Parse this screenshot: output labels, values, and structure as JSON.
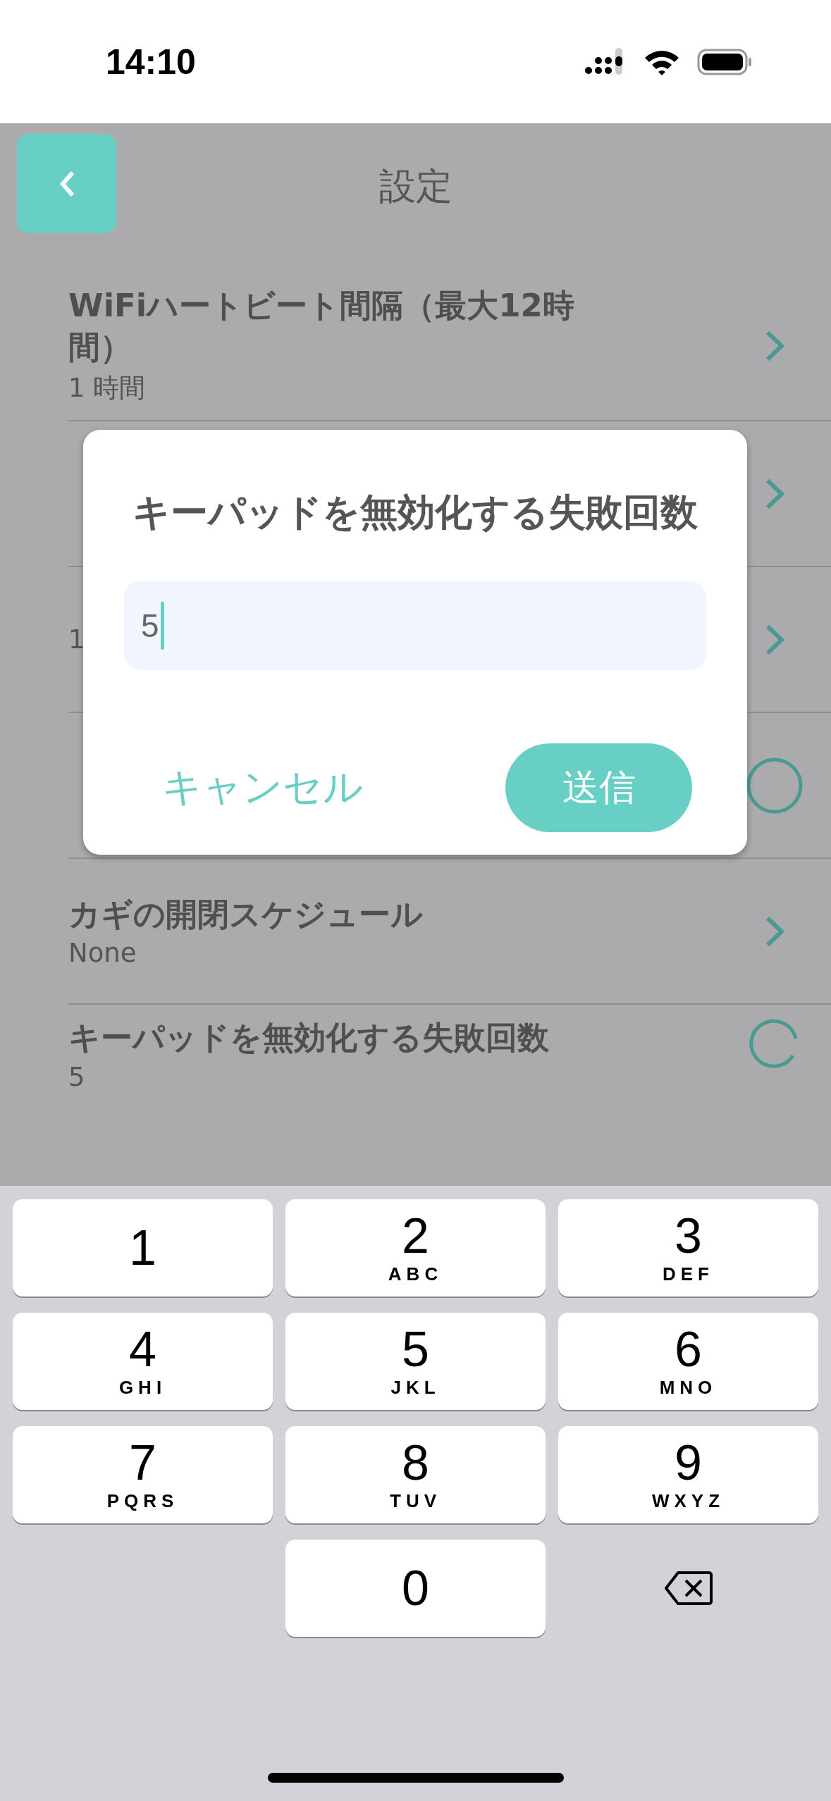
{
  "status_bar": {
    "time": "14:10"
  },
  "header": {
    "title": "設定"
  },
  "settings": [
    {
      "kind": "link",
      "title": "WiFiハートビート間隔（最大12時間）",
      "value": "1 時間"
    },
    {
      "kind": "link"
    },
    {
      "kind": "link",
      "value": "1"
    },
    {
      "kind": "toggle"
    },
    {
      "kind": "link",
      "title": "カギの開閉スケジュール",
      "value": "None"
    },
    {
      "kind": "loading",
      "title": "キーパッドを無効化する失敗回数",
      "value": "5"
    }
  ],
  "dialog": {
    "title": "キーパッドを無効化する失敗回数",
    "input_value": "5",
    "cancel": "キャンセル",
    "submit": "送信"
  },
  "keypad": [
    {
      "kind": "digit",
      "digit": "1"
    },
    {
      "kind": "digit",
      "digit": "2",
      "letters": "ABC"
    },
    {
      "kind": "digit",
      "digit": "3",
      "letters": "DEF"
    },
    {
      "kind": "digit",
      "digit": "4",
      "letters": "GHI"
    },
    {
      "kind": "digit",
      "digit": "5",
      "letters": "JKL"
    },
    {
      "kind": "digit",
      "digit": "6",
      "letters": "MNO"
    },
    {
      "kind": "digit",
      "digit": "7",
      "letters": "PQRS"
    },
    {
      "kind": "digit",
      "digit": "8",
      "letters": "TUV"
    },
    {
      "kind": "digit",
      "digit": "9",
      "letters": "WXYZ"
    },
    {
      "kind": "empty"
    },
    {
      "kind": "digit",
      "digit": "0"
    },
    {
      "kind": "delete"
    }
  ]
}
